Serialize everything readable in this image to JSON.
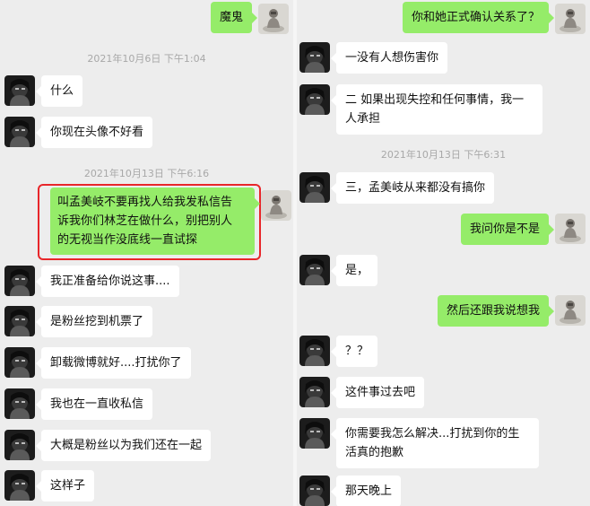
{
  "left": {
    "messages": [
      {
        "text": "魔鬼"
      },
      {
        "text": "什么"
      },
      {
        "text": "你现在头像不好看"
      },
      {
        "text": "叫孟美岐不要再找人给我发私信告\n诉我你们林芝在做什么，别把别人\n的无视当作没底线一直试探"
      },
      {
        "text": "我正准备给你说这事...."
      },
      {
        "text": "是粉丝挖到机票了"
      },
      {
        "text": "卸载微博就好....打扰你了"
      },
      {
        "text": "我也在一直收私信"
      },
      {
        "text": "大概是粉丝以为我们还在一起"
      },
      {
        "text": "这样子"
      }
    ],
    "timestamps": [
      "2021年10月6日 下午1:04",
      "2021年10月13日 下午6:16"
    ]
  },
  "right": {
    "messages": [
      {
        "text": "你和她正式确认关系了？"
      },
      {
        "text": "一没有人想伤害你"
      },
      {
        "text": "二 如果出现失控和任何事情，我一\n人承担"
      },
      {
        "text": "三，孟美岐从来都没有搞你"
      },
      {
        "text": "我问你是不是"
      },
      {
        "text": "是，"
      },
      {
        "text": "然后还跟我说想我"
      },
      {
        "text": "？？"
      },
      {
        "text": "这件事过去吧"
      },
      {
        "text": "你需要我怎么解决...打扰到你的生\n活真的抱歉"
      },
      {
        "text": "那天晚上"
      }
    ],
    "timestamps": [
      "2021年10月13日 下午6:31"
    ]
  },
  "colors": {
    "chat_bg": "#ededed",
    "incoming_bubble": "#ffffff",
    "outgoing_bubble": "#95ec69",
    "highlight_border": "#e8262a",
    "timestamp_text": "#a8a8a8"
  },
  "icons": {
    "contact_avatar": "dark-portrait-avatar-icon",
    "self_avatar": "figurine-avatar-icon"
  }
}
